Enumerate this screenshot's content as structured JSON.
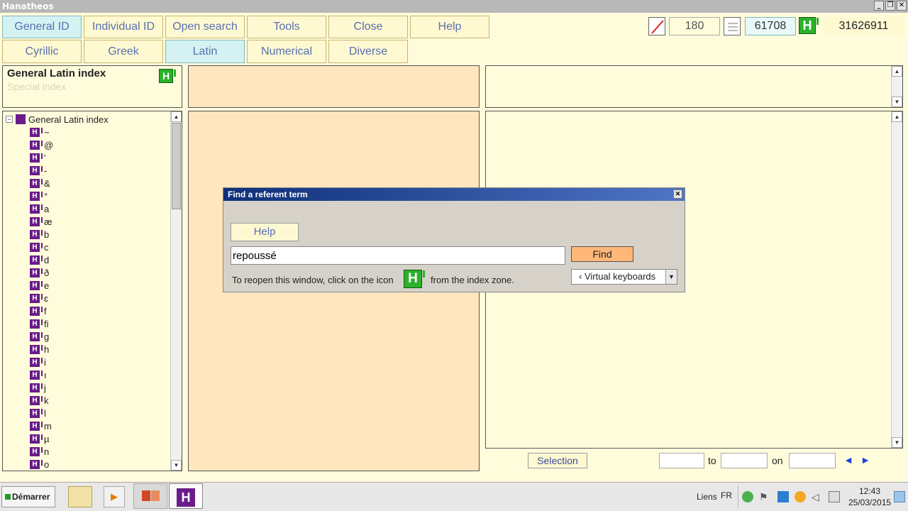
{
  "window": {
    "title": "Hanatheos"
  },
  "toolbar": {
    "buttons": [
      "General ID",
      "Individual ID",
      "Open search",
      "Tools",
      "Close",
      "Help"
    ],
    "counters": {
      "c1": "180",
      "c2": "61708",
      "c3": "31626911"
    }
  },
  "tabs": [
    "Cyrillic",
    "Greek",
    "Latin",
    "Numerical",
    "Diverse"
  ],
  "index_panel": {
    "title": "General Latin index",
    "subtitle": "Special index",
    "logo": "H"
  },
  "tree": {
    "root": "General Latin index",
    "items": [
      "~",
      "@",
      "'",
      "-",
      "&",
      "°",
      "a",
      "æ",
      "b",
      "c",
      "d",
      "ð",
      "e",
      "ɛ",
      "f",
      "fi",
      "g",
      "h",
      "i",
      "ı",
      "j",
      "k",
      "l",
      "m",
      "µ",
      "n",
      "o"
    ]
  },
  "dialog": {
    "title": "Find a referent term",
    "help_label": "Help",
    "input_value": "repoussé",
    "find_label": "Find",
    "hint_before": "To reopen this window, click on the icon",
    "hint_after": "from the index zone.",
    "keyboard_label": "‹ Virtual keyboards"
  },
  "bottom": {
    "selection_label": "Selection",
    "to_label": "to",
    "on_label": "on"
  },
  "taskbar": {
    "start_label": "Démarrer",
    "links_label": "Liens",
    "lang": "FR",
    "time": "12:43",
    "date": "25/03/2015"
  }
}
